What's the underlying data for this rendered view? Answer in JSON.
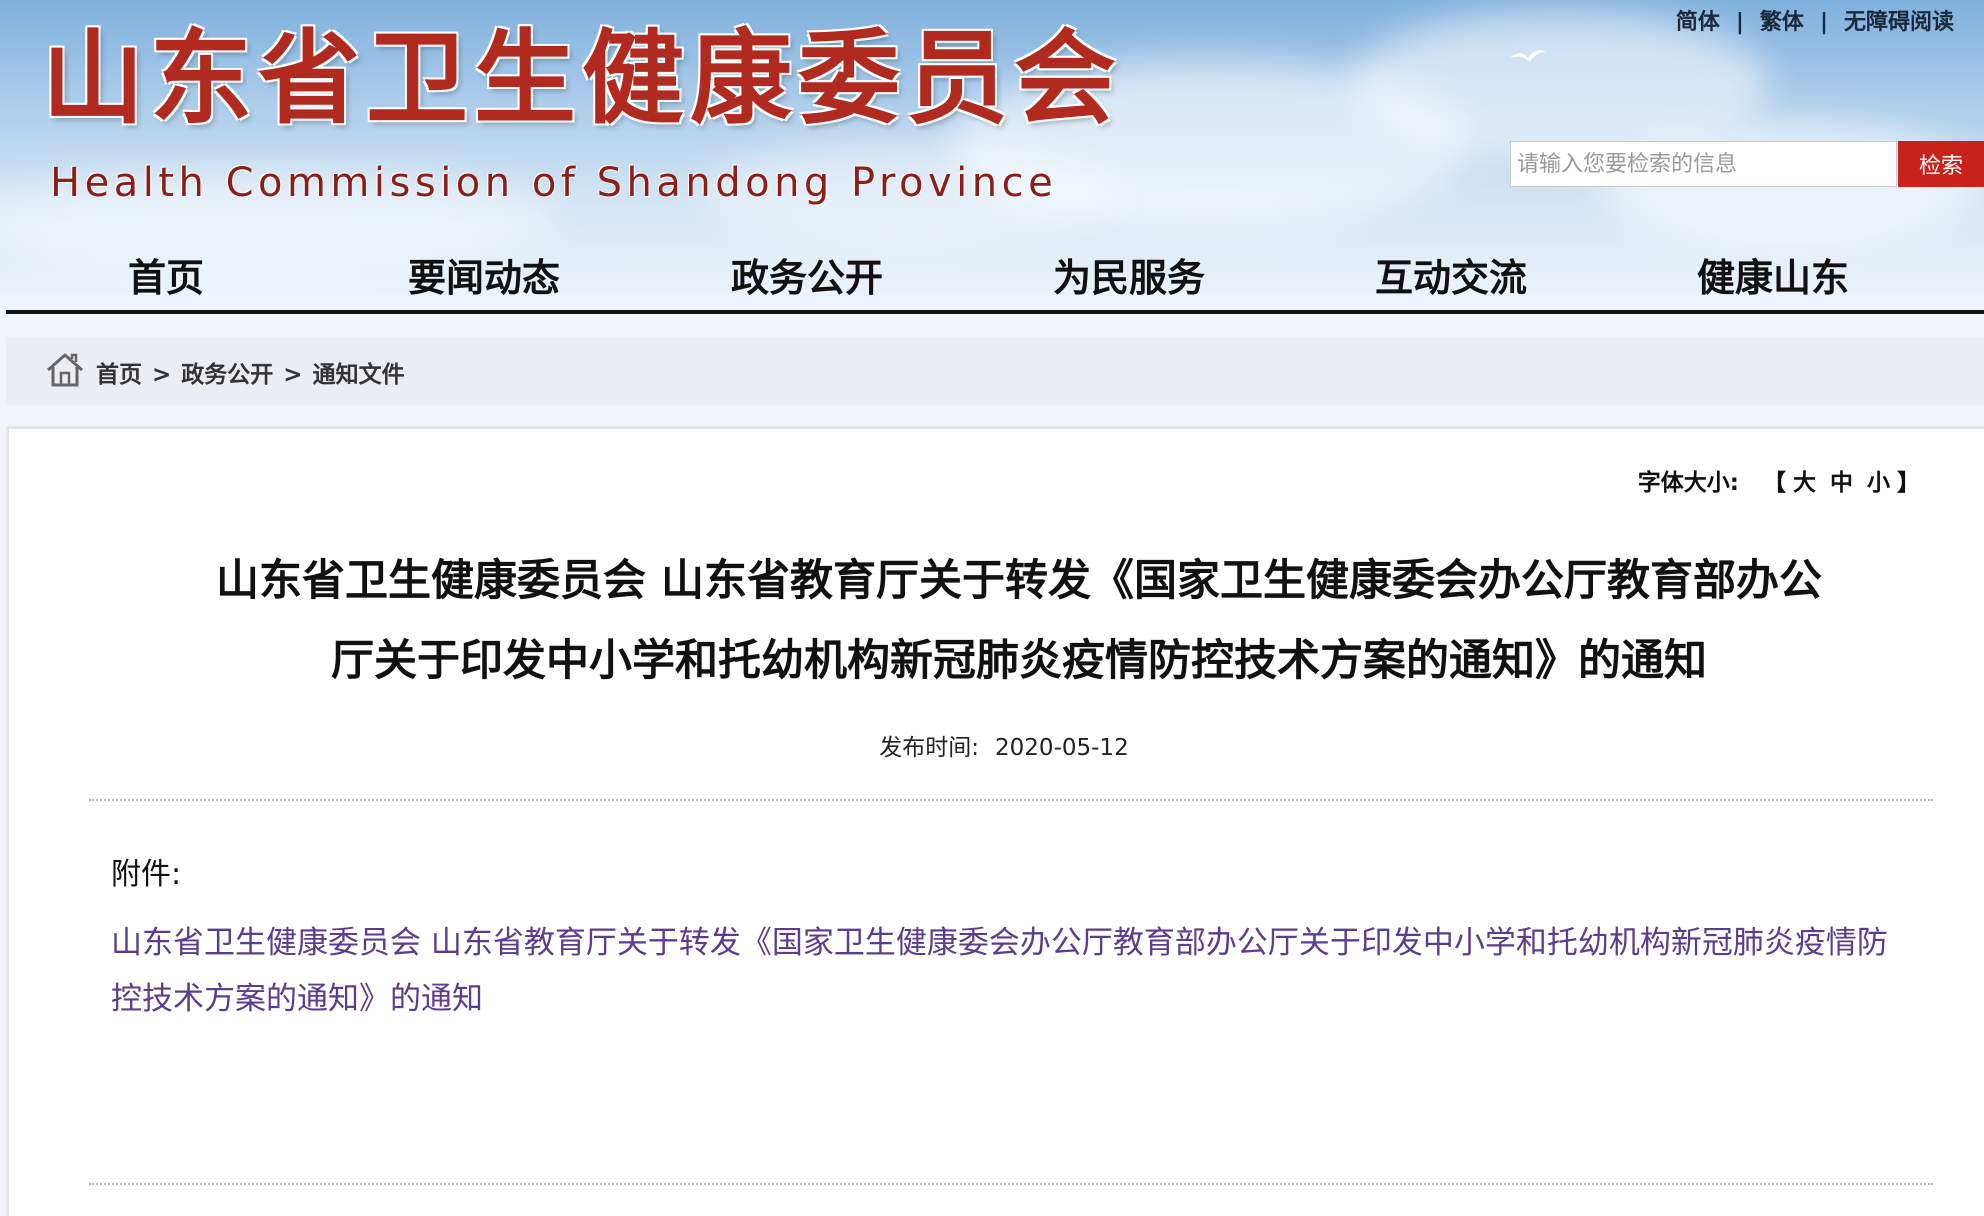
{
  "header": {
    "title_cn": "山东省卫生健康委员会",
    "title_en": "Health Commission of Shandong Province",
    "top_links": [
      "简体",
      "繁体",
      "无障碍阅读"
    ],
    "top_link_separator": "|",
    "search": {
      "placeholder": "请输入您要检索的信息",
      "value": "",
      "button": "检索"
    }
  },
  "nav": {
    "items": [
      "首页",
      "要闻动态",
      "政务公开",
      "为民服务",
      "互动交流",
      "健康山东"
    ]
  },
  "breadcrumb": {
    "items": [
      "首页",
      "政务公开",
      "通知文件"
    ],
    "separator": ">"
  },
  "article": {
    "font_size_label": "字体大小:",
    "font_size_open": "【",
    "font_size_options": [
      "大",
      "中",
      "小"
    ],
    "font_size_close": "】",
    "title_line1": "山东省卫生健康委员会 山东省教育厅关于转发《国家卫生健康委会办公厅教育部办公",
    "title_line2": "厅关于印发中小学和托幼机构新冠肺炎疫情防控技术方案的通知》的通知",
    "publish_label": "发布时间:",
    "publish_date": "2020-05-12",
    "attachment_label": "附件:",
    "attachment_link": "山东省卫生健康委员会 山东省教育厅关于转发《国家卫生健康委会办公厅教育部办公厅关于印发中小学和托幼机构新冠肺炎疫情防控技术方案的通知》的通知"
  },
  "colors": {
    "brand_red": "#b02a20",
    "search_button": "#c8231b",
    "link_purple": "#5b3d8f"
  }
}
